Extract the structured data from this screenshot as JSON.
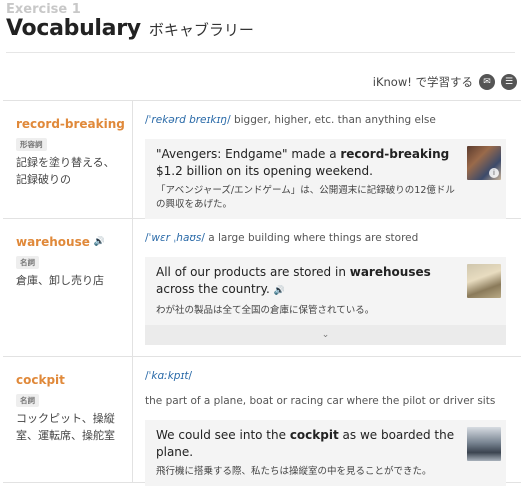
{
  "header": {
    "exercise_label": "Exercise 1",
    "title_en": "Vocabulary",
    "title_ja": "ボキャブラリー"
  },
  "iknow": {
    "label": "iKnow! で学習する",
    "icons": [
      "chat-bubble-icon",
      "add-list-icon"
    ]
  },
  "entries": [
    {
      "word": "record-breaking",
      "has_audio": false,
      "pos": "形容詞",
      "meaning_ja": "記録を塗り替える、記録破りの",
      "ipa": "ˈrekərd breɪkɪŋ",
      "definition": "bigger, higher, etc. than anything else",
      "example_en_before": "\"Avengers: Endgame\" made a ",
      "example_en_bold": "record-breaking",
      "example_en_after": " $1.2 billion on its opening weekend.",
      "example_ja": "「アベンジャーズ/エンドゲーム」は、公開週末に記録破りの12億ドルの興収をあげた。"
    },
    {
      "word": "warehouse",
      "has_audio": true,
      "pos": "名詞",
      "meaning_ja": "倉庫、卸し売り店",
      "ipa": "ˈwɛr ˌhaʊs",
      "definition": "a large building where things are stored",
      "example_en_before": "All of our products are stored in ",
      "example_en_bold": "warehouses",
      "example_en_after": " across the country.",
      "example_ja": "わが社の製品は全て全国の倉庫に保管されている。"
    },
    {
      "word": "cockpit",
      "has_audio": false,
      "pos": "名詞",
      "meaning_ja": "コックピット、操縦室、運転席、操舵室",
      "ipa": "ˈkɑːkpɪt",
      "definition": "the part of a plane, boat or racing car where the pilot or driver sits",
      "example_en_before": "We could see into the ",
      "example_en_bold": "cockpit",
      "example_en_after": " as we boarded the plane.",
      "example_ja": "飛行機に搭乗する際、私たちは操縦室の中を見ることができた。"
    }
  ],
  "colors": {
    "word_accent": "#e0893a",
    "ipa_blue": "#2a6aa8"
  }
}
